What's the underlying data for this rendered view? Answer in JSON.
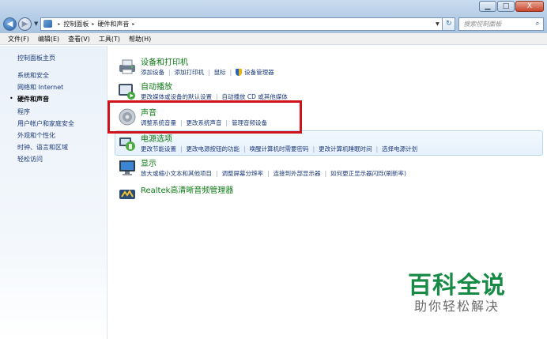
{
  "window": {
    "caption_buttons": {
      "minimize": "▁",
      "maximize": "□",
      "close": "X"
    }
  },
  "nav": {
    "back_glyph": "◀",
    "forward_glyph": "▶",
    "history_dropdown": "▼",
    "address": {
      "crumb_sep": "▸",
      "crumbs": [
        "控制面板",
        "硬件和声音"
      ],
      "dropdown": "▼"
    },
    "refresh_glyph": "↻",
    "search_placeholder": "搜索控制面板",
    "search_glyph": "⌕"
  },
  "menubar": {
    "items": [
      "文件(F)",
      "编辑(E)",
      "查看(V)",
      "工具(T)",
      "帮助(H)"
    ]
  },
  "leftnav": {
    "items": [
      "控制面板主页",
      "系统和安全",
      "网络和 Internet",
      "硬件和声音",
      "程序",
      "用户帐户和家庭安全",
      "外观和个性化",
      "时钟、语言和区域",
      "轻松访问"
    ],
    "current_bullet": "•"
  },
  "categories": [
    {
      "title": "设备和打印机",
      "icon": "printer-icon",
      "links": [
        "添加设备",
        "添加打印机",
        "鼠标",
        "设备管理器"
      ]
    },
    {
      "title": "自动播放",
      "icon": "autoplay-icon",
      "links": [
        "更改媒体或设备的默认设置",
        "自动播放 CD 或其他媒体"
      ]
    },
    {
      "title": "声音",
      "icon": "speaker-icon",
      "links": [
        "调整系统音量",
        "更改系统声音",
        "管理音频设备"
      ]
    },
    {
      "title": "电源选项",
      "icon": "power-options-icon",
      "links": [
        "更改节能设置",
        "更改电源按钮的功能",
        "唤醒计算机时需要密码",
        "更改计算机睡眠时间",
        "选择电源计划"
      ]
    },
    {
      "title": "显示",
      "icon": "display-icon",
      "links": [
        "放大或缩小文本和其他项目",
        "调整屏幕分辨率",
        "连接到外部显示器",
        "如何更正显示器闪烁(刷新率)"
      ]
    },
    {
      "title": "Realtek高清晰音频管理器",
      "icon": "realtek-icon",
      "links": []
    }
  ],
  "link_separator": "|",
  "watermark": {
    "brand": "百科全说",
    "tagline": "助你轻松解决"
  },
  "colors": {
    "category_title": "#0d7a14",
    "link": "#1d3a7a",
    "highlight_box": "#d0121b",
    "watermark": "#178a45"
  }
}
